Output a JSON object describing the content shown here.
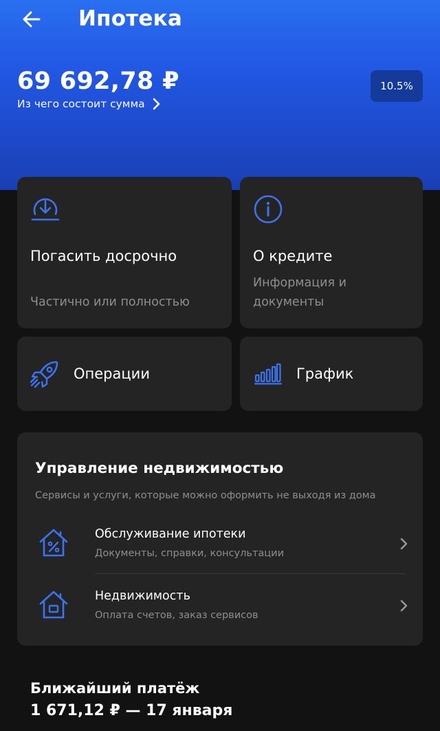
{
  "header": {
    "title": "Ипотека",
    "amount": "69 692,78 ₽",
    "breakdown_label": "Из чего состоит сумма",
    "rate": "10.5%"
  },
  "actions": {
    "prepay": {
      "title": "Погасить досрочно",
      "subtitle": "Частично или полностью"
    },
    "about": {
      "title": "О кредите",
      "subtitle_line1": "Информация и",
      "subtitle_line2": "документы"
    },
    "operations": {
      "title": "Операции"
    },
    "schedule": {
      "title": "График"
    }
  },
  "property_management": {
    "title": "Управление недвижимостью",
    "subtitle": "Сервисы и услуги, которые можно оформить не выходя из дома",
    "items": [
      {
        "title": "Обслуживание ипотеки",
        "subtitle": "Документы, справки, консультации"
      },
      {
        "title": "Недвижимость",
        "subtitle": "Оплата счетов, заказ сервисов"
      }
    ]
  },
  "next_payment": {
    "label": "Ближайший платёж",
    "value": "1 671,12 ₽ — 17 января"
  },
  "colors": {
    "accent_blue": "#3b73f0",
    "card_bg": "#242424",
    "page_bg": "#121212",
    "badge_bg": "#143a9a"
  }
}
